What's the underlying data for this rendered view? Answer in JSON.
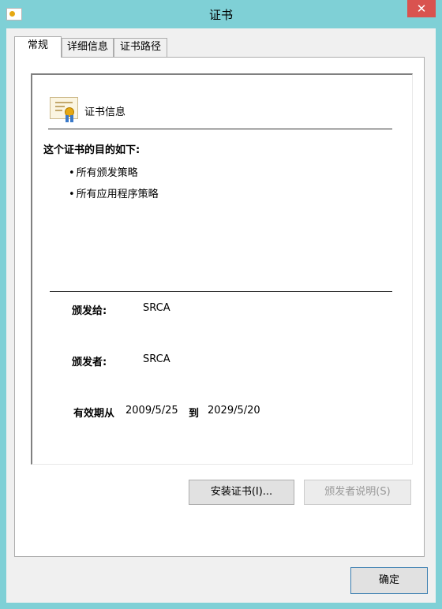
{
  "window": {
    "title": "证书",
    "close_label": "✕",
    "accent_color": "#7fd0d6",
    "close_color": "#d9534f"
  },
  "tabs": [
    {
      "label": "常规",
      "active": true
    },
    {
      "label": "详细信息",
      "active": false
    },
    {
      "label": "证书路径",
      "active": false
    }
  ],
  "cert_info": {
    "title": "证书信息",
    "icon": "certificate-icon",
    "purpose_title": "这个证书的目的如下:",
    "bullet": "•",
    "purposes": [
      "所有颁发策略",
      "所有应用程序策略"
    ]
  },
  "fields": {
    "issued_to_label": "颁发给:",
    "issued_to_value": "SRCA",
    "issued_by_label": "颁发者:",
    "issued_by_value": "SRCA",
    "valid_label": "有效期从",
    "valid_from": "2009/5/25",
    "valid_to_label": "到",
    "valid_to": "2029/5/20"
  },
  "buttons": {
    "install": "安装证书(I)...",
    "issuer_statement": "颁发者说明(S)",
    "ok": "确定"
  }
}
